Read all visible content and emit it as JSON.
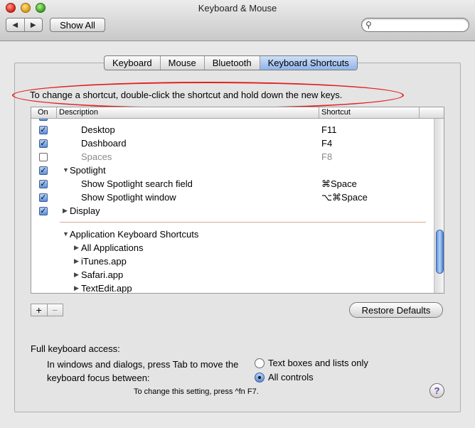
{
  "window": {
    "title": "Keyboard & Mouse"
  },
  "toolbar": {
    "back_glyph": "◀",
    "forward_glyph": "▶",
    "show_all_label": "Show All",
    "search_value": "",
    "search_icon": "magnifier-icon"
  },
  "tabs": [
    {
      "label": "Keyboard",
      "selected": false
    },
    {
      "label": "Mouse",
      "selected": false
    },
    {
      "label": "Bluetooth",
      "selected": false
    },
    {
      "label": "Keyboard Shortcuts",
      "selected": true
    }
  ],
  "instruction": "To change a shortcut, double-click the shortcut and hold down the new keys.",
  "table": {
    "headers": {
      "on": "On",
      "description": "Description",
      "shortcut": "Shortcut"
    },
    "rows": [
      {
        "checked": true,
        "label": "Desktop",
        "shortcut": "F11",
        "dim": false
      },
      {
        "checked": true,
        "label": "Dashboard",
        "shortcut": "F4",
        "dim": false
      },
      {
        "checked": false,
        "label": "Spaces",
        "shortcut": "F8",
        "dim": true
      },
      {
        "checked": true,
        "label": "Spotlight",
        "shortcut": "",
        "dim": false,
        "disclosure": "expanded"
      },
      {
        "checked": true,
        "label": "Show Spotlight search field",
        "shortcut": "⌘Space",
        "dim": false
      },
      {
        "checked": true,
        "label": "Show Spotlight window",
        "shortcut": "⌥⌘Space",
        "dim": false
      },
      {
        "checked": true,
        "label": "Display",
        "shortcut": "",
        "dim": false,
        "disclosure": "collapsed"
      },
      {
        "label": "Application Keyboard Shortcuts",
        "disclosure": "expanded"
      },
      {
        "label": "All Applications",
        "disclosure": "collapsed"
      },
      {
        "label": "iTunes.app",
        "disclosure": "collapsed"
      },
      {
        "label": "Safari.app",
        "disclosure": "collapsed"
      },
      {
        "label": "TextEdit.app",
        "disclosure": "collapsed"
      }
    ]
  },
  "buttons": {
    "add_label": "+",
    "remove_label": "−",
    "restore_label": "Restore Defaults"
  },
  "full_keyboard_access": {
    "title": "Full keyboard access:",
    "description": "In windows and dialogs, press Tab to move the keyboard focus between:",
    "options": [
      {
        "label": "Text boxes and lists only",
        "selected": false
      },
      {
        "label": "All controls",
        "selected": true
      }
    ],
    "hint": "To change this setting, press ^fn F7."
  },
  "help_label": "?"
}
